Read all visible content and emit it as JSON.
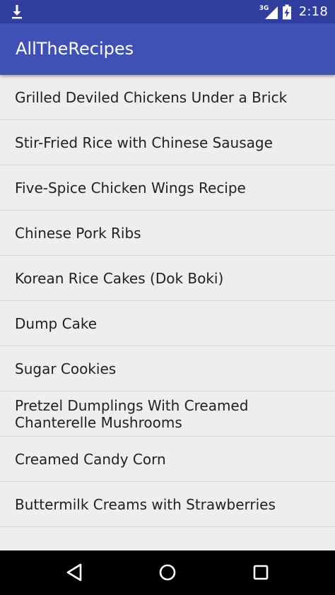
{
  "status_bar": {
    "network_type": "3G",
    "time": "2:18",
    "icons": [
      "download-icon",
      "signal-icon",
      "battery-charging-icon"
    ]
  },
  "app_bar": {
    "title": "AllTheRecipes",
    "color": "#3f51b5",
    "status_color": "#303f9f"
  },
  "recipes": [
    {
      "label": "Grilled Deviled Chickens Under a Brick"
    },
    {
      "label": "Stir-Fried Rice with Chinese Sausage"
    },
    {
      "label": "Five-Spice Chicken Wings Recipe"
    },
    {
      "label": "Chinese Pork Ribs"
    },
    {
      "label": "Korean Rice Cakes (Dok Boki)"
    },
    {
      "label": "Dump Cake"
    },
    {
      "label": "Sugar Cookies"
    },
    {
      "label": "Pretzel Dumplings With Creamed Chanterelle Mushrooms"
    },
    {
      "label": "Creamed Candy Corn"
    },
    {
      "label": "Buttermilk Creams with Strawberries"
    },
    {
      "label": ""
    }
  ],
  "nav_bar": {
    "icons": [
      "back-icon",
      "home-icon",
      "recents-icon"
    ]
  }
}
